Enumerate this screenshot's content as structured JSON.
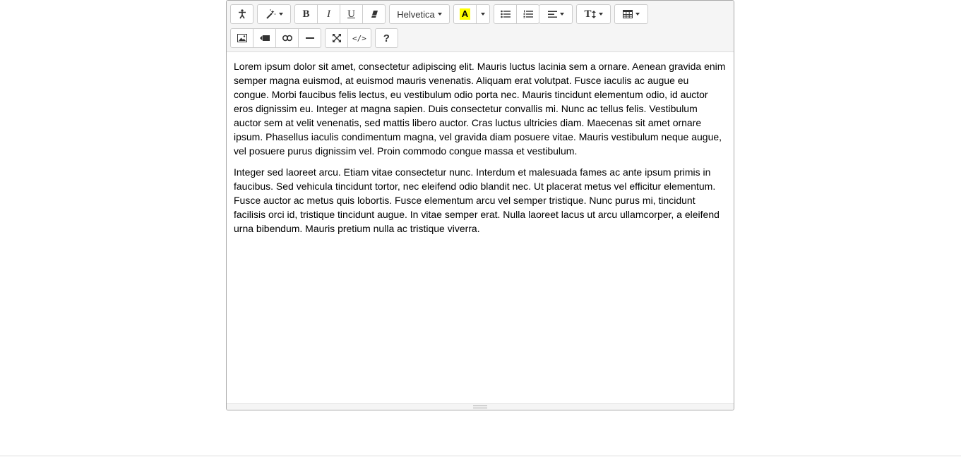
{
  "toolbar": {
    "font_name": "Helvetica",
    "highlight_letter": "A",
    "help_label": "?",
    "code_label": "</>",
    "bold_label": "B",
    "italic_label": "I",
    "underline_label": "U",
    "fontsize_label": "T"
  },
  "content": {
    "paragraphs": [
      "Lorem ipsum dolor sit amet, consectetur adipiscing elit. Mauris luctus lacinia sem a ornare. Aenean gravida enim semper magna euismod, at euismod mauris venenatis. Aliquam erat volutpat. Fusce iaculis ac augue eu congue. Morbi faucibus felis lectus, eu vestibulum odio porta nec. Mauris tincidunt elementum odio, id auctor eros dignissim eu. Integer at magna sapien. Duis consectetur convallis mi. Nunc ac tellus felis. Vestibulum auctor sem at velit venenatis, sed mattis libero auctor. Cras luctus ultricies diam. Maecenas sit amet ornare ipsum. Phasellus iaculis condimentum magna, vel gravida diam posuere vitae. Mauris vestibulum neque augue, vel posuere purus dignissim vel. Proin commodo congue massa et vestibulum.",
      "Integer sed laoreet arcu. Etiam vitae consectetur nunc. Interdum et malesuada fames ac ante ipsum primis in faucibus. Sed vehicula tincidunt tortor, nec eleifend odio blandit nec. Ut placerat metus vel efficitur elementum. Fusce auctor ac metus quis lobortis. Fusce elementum arcu vel semper tristique. Nunc purus mi, tincidunt facilisis orci id, tristique tincidunt augue. In vitae semper erat. Nulla laoreet lacus ut arcu ullamcorper, a eleifend urna bibendum. Mauris pretium nulla ac tristique viverra."
    ]
  },
  "colors": {
    "highlight": "#ffff00",
    "toolbar_bg": "#f5f5f5",
    "border": "#cccccc"
  }
}
